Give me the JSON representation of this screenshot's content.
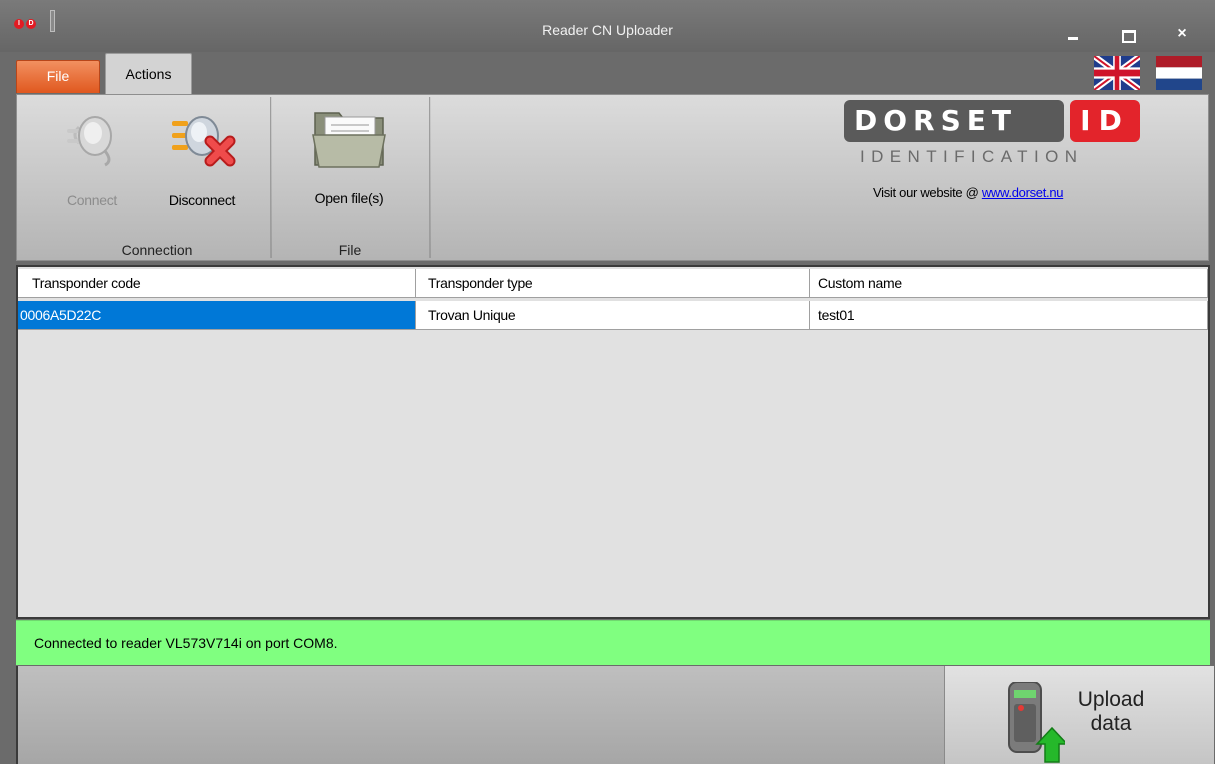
{
  "window": {
    "title": "Reader CN Uploader",
    "app_icon": "red-dots-icon",
    "close_symbol": "×"
  },
  "tabs": [
    {
      "label": "File",
      "color": "#e8682f"
    },
    {
      "label": "Actions",
      "active": true
    }
  ],
  "languages": [
    "uk-flag-icon",
    "nl-flag-icon"
  ],
  "ribbon": {
    "groups": [
      {
        "label": "Connection",
        "buttons": [
          {
            "label": "Connect",
            "icon": "plug-icon",
            "enabled": false
          },
          {
            "label": "Disconnect",
            "icon": "disconnect-plug-icon",
            "enabled": true
          }
        ]
      },
      {
        "label": "File",
        "buttons": [
          {
            "label": "Open file(s)",
            "icon": "folder-icon",
            "enabled": true
          }
        ]
      }
    ],
    "logo": {
      "name": "DORSET",
      "id": "ID",
      "subtitle": "IDENTIFICATION",
      "brand_red": "#e3242b"
    },
    "visit_text": "Visit our website @ ",
    "website": "www.dorset.nu"
  },
  "grid": {
    "columns": [
      "Transponder code",
      "Transponder type",
      "Custom name"
    ],
    "rows": [
      [
        "0006A5D22C",
        "Trovan Unique",
        "test01"
      ]
    ],
    "selection_color": "#0078d7"
  },
  "status": {
    "text": "Connected to reader VL573V714i on port COM8.",
    "color": "#80ff80"
  },
  "upload": {
    "line1": "Upload",
    "line2": "data",
    "icon": "upload-device-icon"
  }
}
